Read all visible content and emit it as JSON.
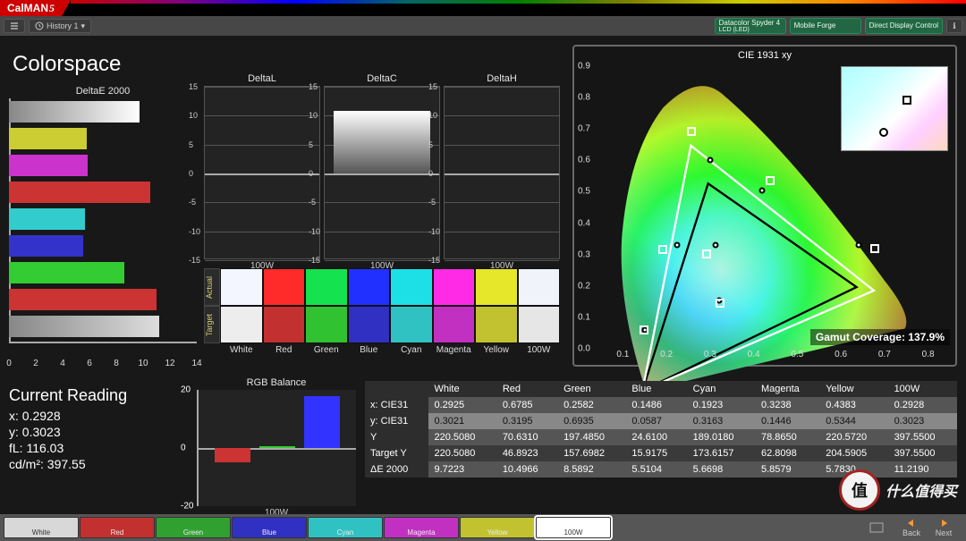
{
  "brand": {
    "name": "CalMAN",
    "suffix": "5"
  },
  "toolbar": {
    "history": "History 1",
    "instruments": [
      {
        "line1": "Datacolor Spyder 4",
        "line2": "LCD (LED)",
        "enabled": true
      },
      {
        "line1": "Mobile Forge",
        "line2": "",
        "enabled": true
      },
      {
        "line1": "Direct Display Control",
        "line2": "",
        "enabled": true
      }
    ]
  },
  "page_title": "Colorspace",
  "chart_data": [
    {
      "type": "bar",
      "title": "DeltaE 2000",
      "orientation": "horizontal",
      "xlim": [
        0,
        14
      ],
      "xticks": [
        0,
        2,
        4,
        6,
        8,
        10,
        12,
        14
      ],
      "categories": [
        "White",
        "Yellow",
        "Magenta",
        "Red",
        "Cyan",
        "Blue",
        "Green",
        "Red2",
        "100W"
      ],
      "values": [
        9.72,
        5.78,
        5.86,
        10.5,
        5.67,
        5.51,
        8.59,
        11.0,
        11.22
      ],
      "colors": [
        "linear-gradient(90deg,#888,#fff)",
        "#cccc33",
        "#cc33cc",
        "#cc3333",
        "#33cccc",
        "#3333cc",
        "#33cc33",
        "#cc3333",
        "linear-gradient(90deg,#888,#ddd)"
      ]
    },
    {
      "type": "bar",
      "title": "DeltaL",
      "ylim": [
        -15,
        15
      ],
      "yticks": [
        15,
        10,
        5,
        0,
        -5,
        -10,
        -15
      ],
      "xlabel": "100W",
      "categories": [
        "100W"
      ],
      "values": [
        0
      ]
    },
    {
      "type": "bar",
      "title": "DeltaC",
      "ylim": [
        -15,
        15
      ],
      "yticks": [
        15,
        10,
        5,
        0,
        -5,
        -10,
        -15
      ],
      "xlabel": "100W",
      "categories": [
        "100W"
      ],
      "values": [
        10.8
      ],
      "bar_fill": "linear-gradient(#fff,#555)"
    },
    {
      "type": "bar",
      "title": "DeltaH",
      "ylim": [
        -15,
        15
      ],
      "yticks": [
        15,
        10,
        5,
        0,
        -5,
        -10,
        -15
      ],
      "xlabel": "100W",
      "categories": [
        "100W"
      ],
      "values": [
        0
      ]
    },
    {
      "type": "bar",
      "title": "RGB Balance",
      "ylim": [
        -20,
        20
      ],
      "yticks": [
        20,
        0,
        -20
      ],
      "xlabel": "100W",
      "categories": [
        "R",
        "G",
        "B"
      ],
      "values": [
        -5,
        0.5,
        18
      ],
      "colors": [
        "#cc3333",
        "#33cc33",
        "#3333ff"
      ]
    },
    {
      "type": "scatter",
      "title": "CIE 1931 xy",
      "xlim": [
        0.05,
        0.85
      ],
      "ylim": [
        0.0,
        0.9
      ],
      "xticks": [
        0.1,
        0.2,
        0.3,
        0.4,
        0.5,
        0.6,
        0.7,
        0.8
      ],
      "yticks": [
        0.0,
        0.1,
        0.2,
        0.3,
        0.4,
        0.5,
        0.6,
        0.7,
        0.8,
        0.9
      ],
      "target_points": [
        {
          "name": "red",
          "x": 0.64,
          "y": 0.33
        },
        {
          "name": "green",
          "x": 0.3,
          "y": 0.6
        },
        {
          "name": "blue",
          "x": 0.15,
          "y": 0.06
        },
        {
          "name": "white",
          "x": 0.3127,
          "y": 0.329
        },
        {
          "name": "yellow",
          "x": 0.42,
          "y": 0.505
        },
        {
          "name": "cyan",
          "x": 0.225,
          "y": 0.329
        },
        {
          "name": "magenta",
          "x": 0.32,
          "y": 0.155
        }
      ],
      "measured_points": [
        {
          "name": "red",
          "x": 0.6785,
          "y": 0.3195
        },
        {
          "name": "green",
          "x": 0.2582,
          "y": 0.6935
        },
        {
          "name": "blue",
          "x": 0.1486,
          "y": 0.0587
        },
        {
          "name": "white",
          "x": 0.2925,
          "y": 0.3021
        },
        {
          "name": "yellow",
          "x": 0.4383,
          "y": 0.5344
        },
        {
          "name": "cyan",
          "x": 0.1923,
          "y": 0.3163
        },
        {
          "name": "magenta",
          "x": 0.3238,
          "y": 0.1446
        }
      ],
      "coverage_label": "Gamut Coverage:",
      "coverage_value": "137.9%"
    }
  ],
  "swatches": {
    "row1_label": "Actual",
    "row2_label": "Target",
    "labels": [
      "White",
      "Red",
      "Green",
      "Blue",
      "Cyan",
      "Magenta",
      "Yellow",
      "100W"
    ],
    "actual_colors": [
      "#f3f6ff",
      "#ff2a2a",
      "#14e24e",
      "#2230ff",
      "#1de0e6",
      "#ff2ae6",
      "#e6e62a",
      "#f0f3fa"
    ],
    "target_colors": [
      "#ededed",
      "#c23030",
      "#30c230",
      "#3030c2",
      "#30c2c2",
      "#c230c2",
      "#c2c230",
      "#e6e6e6"
    ]
  },
  "reading": {
    "title": "Current Reading",
    "rows": [
      {
        "label": "x:",
        "value": "0.2928"
      },
      {
        "label": "y:",
        "value": "0.3023"
      },
      {
        "label": "fL:",
        "value": "116.03"
      },
      {
        "label": "cd/m²:",
        "value": "397.55"
      }
    ]
  },
  "table": {
    "headers": [
      "",
      "White",
      "Red",
      "Green",
      "Blue",
      "Cyan",
      "Magenta",
      "Yellow",
      "100W"
    ],
    "rows": [
      {
        "label": "x: CIE31",
        "cells": [
          "0.2925",
          "0.6785",
          "0.2582",
          "0.1486",
          "0.1923",
          "0.3238",
          "0.4383",
          "0.2928"
        ]
      },
      {
        "label": "y: CIE31",
        "cells": [
          "0.3021",
          "0.3195",
          "0.6935",
          "0.0587",
          "0.3163",
          "0.1446",
          "0.5344",
          "0.3023"
        ],
        "selected": true
      },
      {
        "label": "Y",
        "cells": [
          "220.5080",
          "70.6310",
          "197.4850",
          "24.6100",
          "189.0180",
          "78.8650",
          "220.5720",
          "397.5500"
        ]
      },
      {
        "label": "Target Y",
        "cells": [
          "220.5080",
          "46.8923",
          "157.6982",
          "15.9175",
          "173.6157",
          "62.8098",
          "204.5905",
          "397.5500"
        ]
      },
      {
        "label": "ΔE 2000",
        "cells": [
          "9.7223",
          "10.4966",
          "8.5892",
          "5.5104",
          "5.6698",
          "5.8579",
          "5.7830",
          "11.2190"
        ]
      }
    ]
  },
  "bottom_tabs": {
    "items": [
      {
        "label": "White",
        "color": "#d8d8d8"
      },
      {
        "label": "Red",
        "color": "#c23030"
      },
      {
        "label": "Green",
        "color": "#30a030"
      },
      {
        "label": "Blue",
        "color": "#3030c2"
      },
      {
        "label": "Cyan",
        "color": "#30c2c2"
      },
      {
        "label": "Magenta",
        "color": "#c230c2"
      },
      {
        "label": "Yellow",
        "color": "#c2c230"
      },
      {
        "label": "100W",
        "color": "#ffffff",
        "active": true
      }
    ],
    "nav": {
      "back": "Back",
      "next": "Next"
    }
  },
  "watermark": {
    "circle": "值",
    "text": "什么值得买"
  }
}
